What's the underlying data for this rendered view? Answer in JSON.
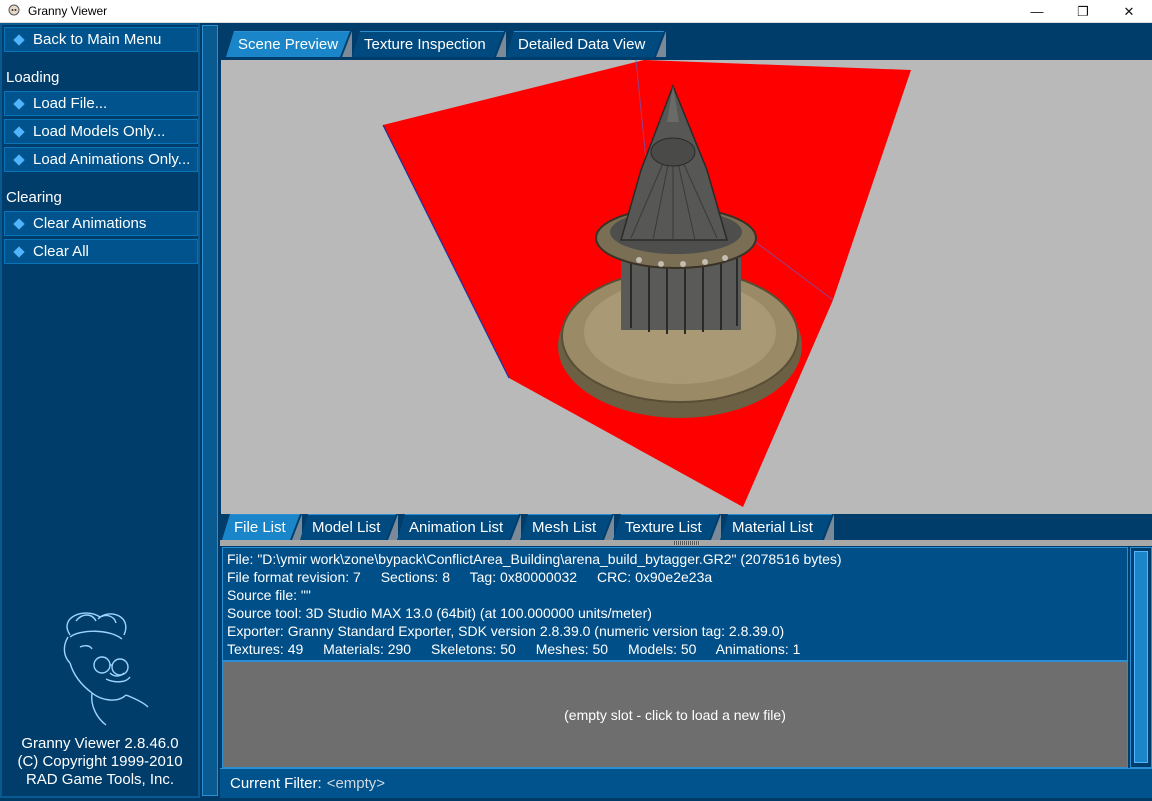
{
  "window": {
    "title": "Granny Viewer",
    "minimize_glyph": "—",
    "restore_glyph": "❐",
    "close_glyph": "✕"
  },
  "sidebar": {
    "back_button": "Back to Main Menu",
    "loading_header": "Loading",
    "loading_items": [
      "Load File...",
      "Load Models Only...",
      "Load Animations Only..."
    ],
    "clearing_header": "Clearing",
    "clearing_items": [
      "Clear Animations",
      "Clear All"
    ],
    "credits": [
      "Granny Viewer 2.8.46.0",
      "(C) Copyright 1999-2010",
      "RAD Game Tools, Inc."
    ]
  },
  "main_tabs": [
    {
      "label": "Scene Preview",
      "active": true
    },
    {
      "label": "Texture Inspection",
      "active": false
    },
    {
      "label": "Detailed Data View",
      "active": false
    }
  ],
  "bottom_tabs": [
    {
      "label": "File List",
      "active": true
    },
    {
      "label": "Model List",
      "active": false
    },
    {
      "label": "Animation List",
      "active": false
    },
    {
      "label": "Mesh List",
      "active": false
    },
    {
      "label": "Texture List",
      "active": false
    },
    {
      "label": "Material List",
      "active": false
    }
  ],
  "file_info": {
    "file_line": "File: \"D:\\ymir work\\zone\\bypack\\ConflictArea_Building\\arena_build_bytagger.GR2\" (2078516 bytes)",
    "format_revision": "File format revision: 7",
    "sections": "Sections: 8",
    "tag": "Tag: 0x80000032",
    "crc": "CRC: 0x90e2e23a",
    "source_file": "Source file: \"\"",
    "source_tool": "Source tool: 3D Studio MAX 13.0 (64bit) (at 100.000000 units/meter)",
    "exporter": "Exporter: Granny Standard Exporter, SDK version 2.8.39.0 (numeric version tag: 2.8.39.0)",
    "textures": "Textures: 49",
    "materials": "Materials: 290",
    "skeletons": "Skeletons: 50",
    "meshes": "Meshes: 50",
    "models": "Models: 50",
    "animations": "Animations: 1"
  },
  "empty_slot": "(empty slot - click to load a new file)",
  "filter": {
    "label": "Current Filter:",
    "value": "<empty>"
  },
  "colors": {
    "panel": "#003d6b",
    "button": "#00538c",
    "accent": "#1a86c9",
    "bbox_red": "#ff0000",
    "viewport_bg": "#b9b9b9"
  }
}
